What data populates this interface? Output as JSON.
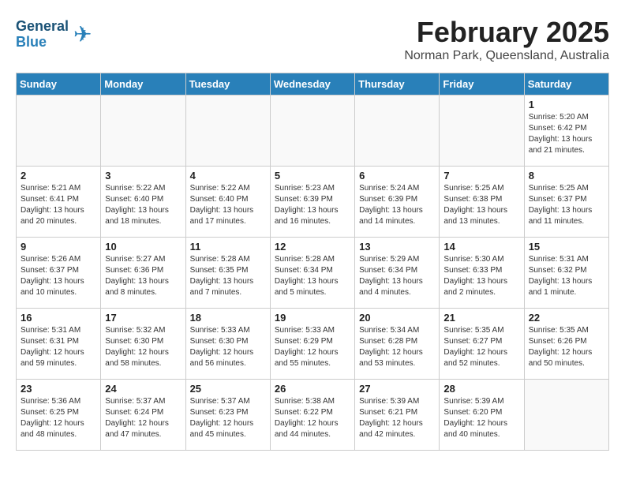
{
  "header": {
    "logo_line1": "General",
    "logo_line2": "Blue",
    "month_year": "February 2025",
    "location": "Norman Park, Queensland, Australia"
  },
  "weekdays": [
    "Sunday",
    "Monday",
    "Tuesday",
    "Wednesday",
    "Thursday",
    "Friday",
    "Saturday"
  ],
  "weeks": [
    [
      {
        "day": "",
        "info": ""
      },
      {
        "day": "",
        "info": ""
      },
      {
        "day": "",
        "info": ""
      },
      {
        "day": "",
        "info": ""
      },
      {
        "day": "",
        "info": ""
      },
      {
        "day": "",
        "info": ""
      },
      {
        "day": "1",
        "info": "Sunrise: 5:20 AM\nSunset: 6:42 PM\nDaylight: 13 hours\nand 21 minutes."
      }
    ],
    [
      {
        "day": "2",
        "info": "Sunrise: 5:21 AM\nSunset: 6:41 PM\nDaylight: 13 hours\nand 20 minutes."
      },
      {
        "day": "3",
        "info": "Sunrise: 5:22 AM\nSunset: 6:40 PM\nDaylight: 13 hours\nand 18 minutes."
      },
      {
        "day": "4",
        "info": "Sunrise: 5:22 AM\nSunset: 6:40 PM\nDaylight: 13 hours\nand 17 minutes."
      },
      {
        "day": "5",
        "info": "Sunrise: 5:23 AM\nSunset: 6:39 PM\nDaylight: 13 hours\nand 16 minutes."
      },
      {
        "day": "6",
        "info": "Sunrise: 5:24 AM\nSunset: 6:39 PM\nDaylight: 13 hours\nand 14 minutes."
      },
      {
        "day": "7",
        "info": "Sunrise: 5:25 AM\nSunset: 6:38 PM\nDaylight: 13 hours\nand 13 minutes."
      },
      {
        "day": "8",
        "info": "Sunrise: 5:25 AM\nSunset: 6:37 PM\nDaylight: 13 hours\nand 11 minutes."
      }
    ],
    [
      {
        "day": "9",
        "info": "Sunrise: 5:26 AM\nSunset: 6:37 PM\nDaylight: 13 hours\nand 10 minutes."
      },
      {
        "day": "10",
        "info": "Sunrise: 5:27 AM\nSunset: 6:36 PM\nDaylight: 13 hours\nand 8 minutes."
      },
      {
        "day": "11",
        "info": "Sunrise: 5:28 AM\nSunset: 6:35 PM\nDaylight: 13 hours\nand 7 minutes."
      },
      {
        "day": "12",
        "info": "Sunrise: 5:28 AM\nSunset: 6:34 PM\nDaylight: 13 hours\nand 5 minutes."
      },
      {
        "day": "13",
        "info": "Sunrise: 5:29 AM\nSunset: 6:34 PM\nDaylight: 13 hours\nand 4 minutes."
      },
      {
        "day": "14",
        "info": "Sunrise: 5:30 AM\nSunset: 6:33 PM\nDaylight: 13 hours\nand 2 minutes."
      },
      {
        "day": "15",
        "info": "Sunrise: 5:31 AM\nSunset: 6:32 PM\nDaylight: 13 hours\nand 1 minute."
      }
    ],
    [
      {
        "day": "16",
        "info": "Sunrise: 5:31 AM\nSunset: 6:31 PM\nDaylight: 12 hours\nand 59 minutes."
      },
      {
        "day": "17",
        "info": "Sunrise: 5:32 AM\nSunset: 6:30 PM\nDaylight: 12 hours\nand 58 minutes."
      },
      {
        "day": "18",
        "info": "Sunrise: 5:33 AM\nSunset: 6:30 PM\nDaylight: 12 hours\nand 56 minutes."
      },
      {
        "day": "19",
        "info": "Sunrise: 5:33 AM\nSunset: 6:29 PM\nDaylight: 12 hours\nand 55 minutes."
      },
      {
        "day": "20",
        "info": "Sunrise: 5:34 AM\nSunset: 6:28 PM\nDaylight: 12 hours\nand 53 minutes."
      },
      {
        "day": "21",
        "info": "Sunrise: 5:35 AM\nSunset: 6:27 PM\nDaylight: 12 hours\nand 52 minutes."
      },
      {
        "day": "22",
        "info": "Sunrise: 5:35 AM\nSunset: 6:26 PM\nDaylight: 12 hours\nand 50 minutes."
      }
    ],
    [
      {
        "day": "23",
        "info": "Sunrise: 5:36 AM\nSunset: 6:25 PM\nDaylight: 12 hours\nand 48 minutes."
      },
      {
        "day": "24",
        "info": "Sunrise: 5:37 AM\nSunset: 6:24 PM\nDaylight: 12 hours\nand 47 minutes."
      },
      {
        "day": "25",
        "info": "Sunrise: 5:37 AM\nSunset: 6:23 PM\nDaylight: 12 hours\nand 45 minutes."
      },
      {
        "day": "26",
        "info": "Sunrise: 5:38 AM\nSunset: 6:22 PM\nDaylight: 12 hours\nand 44 minutes."
      },
      {
        "day": "27",
        "info": "Sunrise: 5:39 AM\nSunset: 6:21 PM\nDaylight: 12 hours\nand 42 minutes."
      },
      {
        "day": "28",
        "info": "Sunrise: 5:39 AM\nSunset: 6:20 PM\nDaylight: 12 hours\nand 40 minutes."
      },
      {
        "day": "",
        "info": ""
      }
    ]
  ]
}
